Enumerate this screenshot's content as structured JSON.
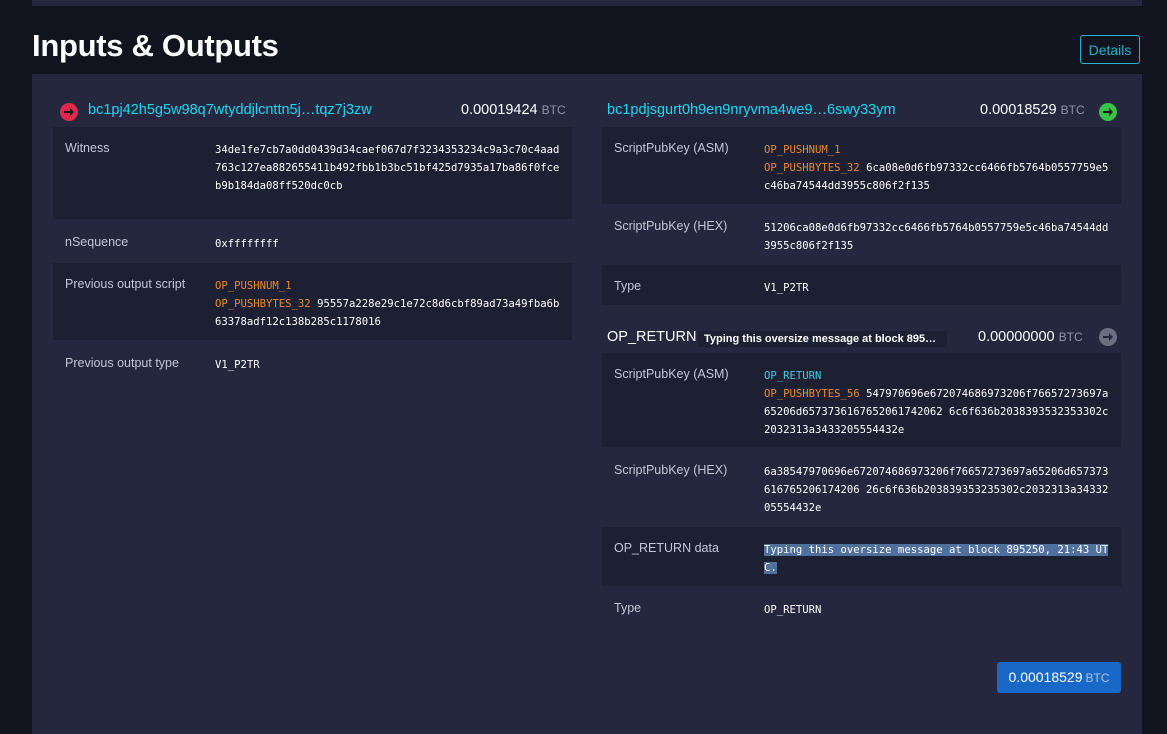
{
  "section": {
    "title": "Inputs & Outputs",
    "details_label": "Details"
  },
  "input": {
    "address": "bc1pj42h5g5w98q7wtyddjlcnttn5j…tqz7j3zw",
    "amount": "0.00019424",
    "unit": "BTC",
    "rows": [
      {
        "label": "Witness",
        "value": "34de1fe7cb7a0dd0439d34caef067d7f3234353234c9a3c70c4aad763c127ea882655411b492fbb1b3bc51bf425d7935a17ba86f0fceb9b184da08ff520dc0cb"
      },
      {
        "label": "nSequence",
        "value": "0xffffffff"
      },
      {
        "label": "Previous output script",
        "op1": "OP_PUSHNUM_1",
        "op2": "OP_PUSHBYTES_32",
        "value": "95557a228e29c1e72c8d6cbf89ad73a49fba6b63378adf12c138b285c1178016"
      },
      {
        "label": "Previous output type",
        "value": "V1_P2TR"
      }
    ]
  },
  "output1": {
    "address": "bc1pdjsgurt0h9en9nryvma4we9…6swy33ym",
    "amount": "0.00018529",
    "unit": "BTC",
    "rows": [
      {
        "label": "ScriptPubKey (ASM)",
        "op1": "OP_PUSHNUM_1",
        "op2": "OP_PUSHBYTES_32",
        "value": "6ca08e0d6fb97332cc6466fb5764b0557759e5c46ba74544dd3955c806f2f135"
      },
      {
        "label": "ScriptPubKey (HEX)",
        "value": "51206ca08e0d6fb97332cc6466fb5764b0557759e5c46ba74544dd3955c806f2f135"
      },
      {
        "label": "Type",
        "value": "V1_P2TR"
      }
    ]
  },
  "output2": {
    "label": "OP_RETURN",
    "tag": "Typing this oversize message at block 895…",
    "amount": "0.00000000",
    "unit": "BTC",
    "rows": [
      {
        "label": "ScriptPubKey (ASM)",
        "op1": "OP_RETURN",
        "op2": "OP_PUSHBYTES_56",
        "value": "547970696e672074686973206f76657273697a65206d6573736167652061742062 6c6f636b2038393532353302c2032313a3433205554432e"
      },
      {
        "label": "ScriptPubKey (HEX)",
        "value": "6a38547970696e672074686973206f76657273697a65206d657373616765206174206 26c6f636b203839353235302c2032313a3433205554432e"
      },
      {
        "label": "OP_RETURN data",
        "value": "Typing this oversize message at block 895250, 21:43 UTC."
      },
      {
        "label": "Type",
        "value": "OP_RETURN"
      }
    ]
  },
  "total": {
    "amount": "0.00018529",
    "unit": "BTC"
  },
  "colors": {
    "accent": "#1bd8f4",
    "input_icon": "#e0284a",
    "output_icon": "#3bc14a",
    "opreturn_icon": "#6b6f80",
    "total_bg": "#1868c7"
  }
}
